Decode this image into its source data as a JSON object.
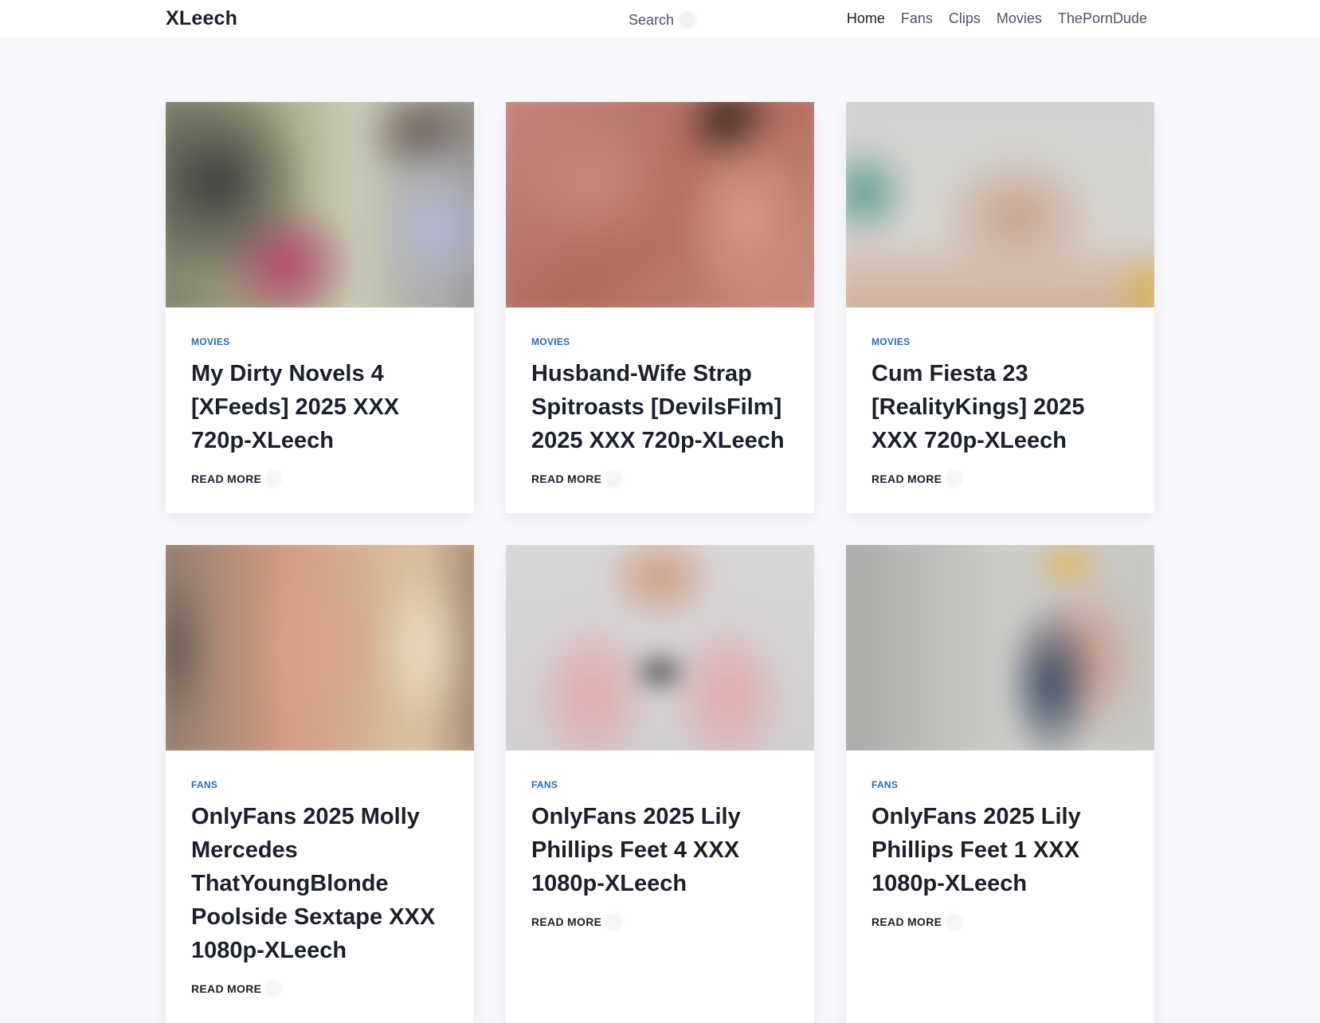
{
  "header": {
    "brand": "XLeech",
    "search_label": "Search",
    "search_icon": "search-icon",
    "nav": [
      {
        "label": "Home",
        "active": true
      },
      {
        "label": "Fans",
        "active": false
      },
      {
        "label": "Clips",
        "active": false
      },
      {
        "label": "Movies",
        "active": false
      },
      {
        "label": "ThePornDude",
        "active": false
      }
    ]
  },
  "colors": {
    "page_background": "#f6f8fb",
    "card_background": "#ffffff",
    "category_accent": "#2a6cb0",
    "title_text": "#1a202c"
  },
  "posts": [
    {
      "category": "MOVIES",
      "title": "My Dirty Novels 4 [XFeeds] 2025 XXX 720p-XLeech",
      "read_more": "READ MORE"
    },
    {
      "category": "MOVIES",
      "title": "Husband-Wife Strap Spitroasts [DevilsFilm] 2025 XXX 720p-XLeech",
      "read_more": "READ MORE"
    },
    {
      "category": "MOVIES",
      "title": "Cum Fiesta 23 [RealityKings] 2025 XXX 720p-XLeech",
      "read_more": "READ MORE"
    },
    {
      "category": "FANS",
      "title": "OnlyFans 2025 Molly Mercedes ThatYoungBlonde Poolside Sextape XXX 1080p-XLeech",
      "read_more": "READ MORE"
    },
    {
      "category": "FANS",
      "title": "OnlyFans 2025 Lily Phillips Feet 4 XXX 1080p-XLeech",
      "read_more": "READ MORE"
    },
    {
      "category": "FANS",
      "title": "OnlyFans 2025 Lily Phillips Feet 1 XXX 1080p-XLeech",
      "read_more": "READ MORE"
    }
  ]
}
